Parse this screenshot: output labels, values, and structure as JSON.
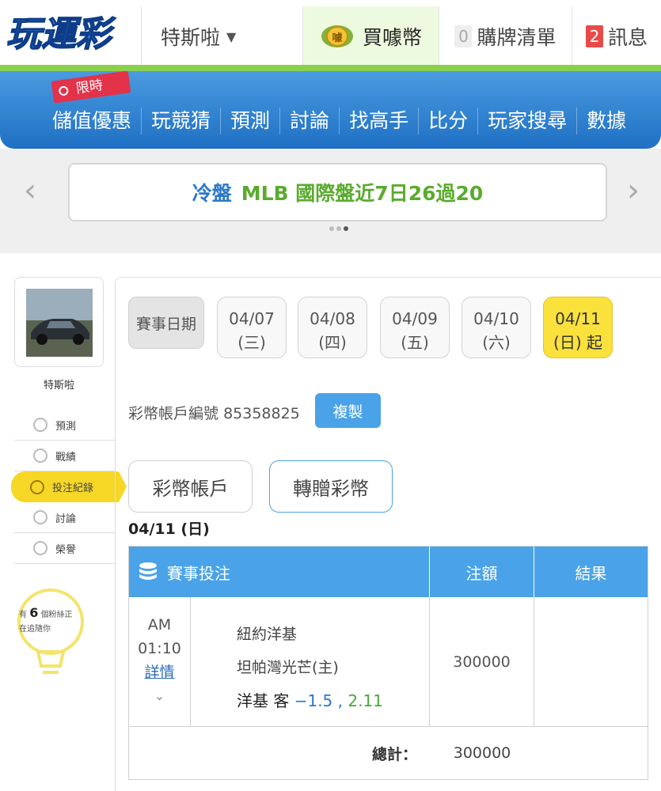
{
  "topbar": {
    "logo_text": "玩運彩",
    "user_name": "特斯啦",
    "coin_label": "買噱幣",
    "coin_icon_char": "噱",
    "cart_count": "0",
    "cart_label": "購牌清單",
    "msg_count": "2",
    "msg_label": "訊息"
  },
  "nav": {
    "promo_tag": "限時",
    "items": [
      "儲值優惠",
      "玩競猜",
      "預測",
      "討論",
      "找高手",
      "比分",
      "玩家搜尋",
      "數據"
    ]
  },
  "banner": {
    "text_a": "冷盤",
    "text_b": "MLB 國際盤近7日26過20",
    "prev": "‹",
    "next": "›"
  },
  "sidebar": {
    "name": "特斯啦",
    "menu": [
      {
        "label": "預測",
        "icon": "target-icon"
      },
      {
        "label": "戰績",
        "icon": "chart-icon"
      },
      {
        "label": "投注紀錄",
        "icon": "circle-icon"
      },
      {
        "label": "討論",
        "icon": "chat-icon"
      },
      {
        "label": "榮譽",
        "icon": "medal-icon"
      }
    ],
    "follow_pre": "有",
    "follow_count": "6",
    "follow_mid": "個粉絲正",
    "follow_post": "在追隨你"
  },
  "main": {
    "date_label": "賽事日期",
    "dates": [
      {
        "date": "04/07",
        "day": "(三)"
      },
      {
        "date": "04/08",
        "day": "(四)"
      },
      {
        "date": "04/09",
        "day": "(五)"
      },
      {
        "date": "04/10",
        "day": "(六)"
      },
      {
        "date": "04/11",
        "day": "(日) 起"
      }
    ],
    "account_label": "彩幣帳戶編號",
    "account_no": "85358825",
    "copy_label": "複製",
    "tab_account": "彩幣帳戶",
    "tab_transfer": "轉贈彩幣",
    "selected_date": "04/11 (日)",
    "table": {
      "h_bet": "賽事投注",
      "h_amount": "注額",
      "h_result": "結果",
      "row": {
        "ampm": "AM",
        "time": "01:10",
        "detail": "詳情",
        "chev": "⌄",
        "team_a": "紐約洋基",
        "team_b": "坦帕灣光芒(主)",
        "bet_team": "洋基 客",
        "handicap": "−1.5",
        "odds_sep": " , ",
        "odds": "2.11",
        "amount": "300000",
        "result": ""
      },
      "total_label": "總計：",
      "total_amount": "300000"
    }
  }
}
